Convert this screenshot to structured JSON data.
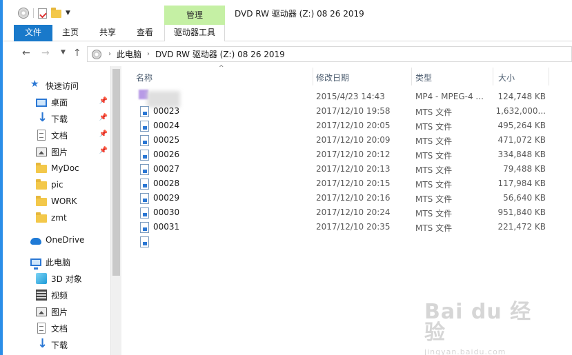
{
  "window": {
    "title": "DVD RW 驱动器 (Z:) 08 26 2019",
    "context_tab_group": "管理"
  },
  "ribbon": {
    "tabs": [
      "文件",
      "主页",
      "共享",
      "查看",
      "驱动器工具"
    ]
  },
  "address": {
    "crumbs": [
      "此电脑",
      "DVD RW 驱动器 (Z:) 08 26 2019"
    ]
  },
  "sidebar": {
    "quick_access": "快速访问",
    "items": [
      {
        "label": "桌面",
        "icon": "desktop-icon",
        "pinned": true
      },
      {
        "label": "下载",
        "icon": "download-icon",
        "pinned": true
      },
      {
        "label": "文档",
        "icon": "document-icon",
        "pinned": true
      },
      {
        "label": "图片",
        "icon": "pictures-icon",
        "pinned": true
      },
      {
        "label": "MyDoc",
        "icon": "folder-icon",
        "pinned": false
      },
      {
        "label": "pic",
        "icon": "folder-icon",
        "pinned": false
      },
      {
        "label": "WORK",
        "icon": "folder-icon",
        "pinned": false
      },
      {
        "label": "zmt",
        "icon": "folder-icon",
        "pinned": false
      }
    ],
    "onedrive": "OneDrive",
    "this_pc": "此电脑",
    "pc_items": [
      {
        "label": "3D 对象",
        "icon": "3d-objects-icon"
      },
      {
        "label": "视频",
        "icon": "video-icon"
      },
      {
        "label": "图片",
        "icon": "pictures-icon"
      },
      {
        "label": "文档",
        "icon": "document-icon"
      },
      {
        "label": "下载",
        "icon": "download-icon"
      }
    ]
  },
  "columns": {
    "name": "名称",
    "date": "修改日期",
    "type": "类型",
    "size": "大小"
  },
  "files": [
    {
      "name": "",
      "date": "2015/4/23 14:43",
      "type": "MP4 - MPEG-4 ...",
      "size": "124,748 KB",
      "blurred": true
    },
    {
      "name": "00023",
      "date": "2017/12/10 19:58",
      "type": "MTS 文件",
      "size": "1,632,000..."
    },
    {
      "name": "00024",
      "date": "2017/12/10 20:05",
      "type": "MTS 文件",
      "size": "495,264 KB"
    },
    {
      "name": "00025",
      "date": "2017/12/10 20:09",
      "type": "MTS 文件",
      "size": "471,072 KB"
    },
    {
      "name": "00026",
      "date": "2017/12/10 20:12",
      "type": "MTS 文件",
      "size": "334,848 KB"
    },
    {
      "name": "00027",
      "date": "2017/12/10 20:13",
      "type": "MTS 文件",
      "size": "79,488 KB"
    },
    {
      "name": "00028",
      "date": "2017/12/10 20:15",
      "type": "MTS 文件",
      "size": "117,984 KB"
    },
    {
      "name": "00029",
      "date": "2017/12/10 20:16",
      "type": "MTS 文件",
      "size": "56,640 KB"
    },
    {
      "name": "00030",
      "date": "2017/12/10 20:24",
      "type": "MTS 文件",
      "size": "951,840 KB"
    },
    {
      "name": "00031",
      "date": "2017/12/10 20:35",
      "type": "MTS 文件",
      "size": "221,472 KB"
    }
  ],
  "watermark": {
    "brand": "Bai du 经验",
    "url": "jingyan.baidu.com"
  },
  "colors": {
    "accent": "#1979ca",
    "context_tab": "#c5f0a4",
    "left_accent": "#2b8ee8"
  }
}
